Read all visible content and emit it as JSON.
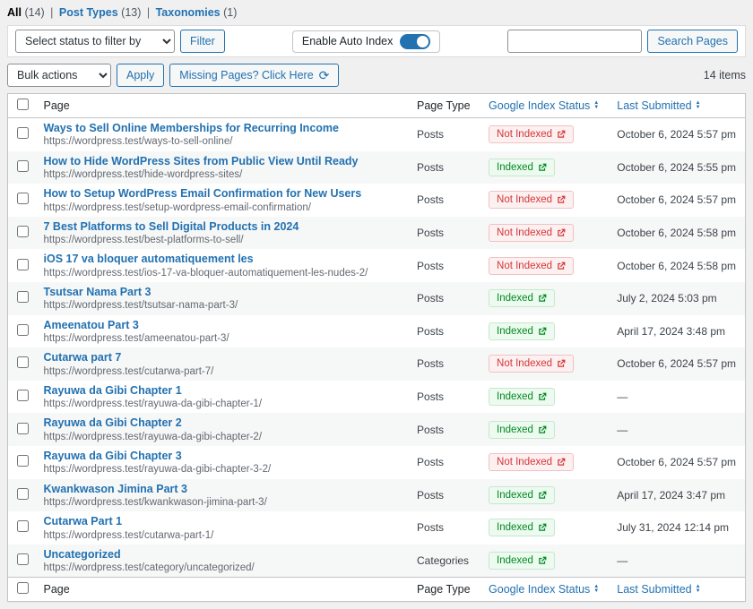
{
  "views": [
    {
      "label": "All",
      "count": "(14)"
    },
    {
      "label": "Post Types",
      "count": "(13)"
    },
    {
      "label": "Taxonomies",
      "count": "(1)"
    }
  ],
  "filters": {
    "status_placeholder": "Select status to filter by",
    "filter_button": "Filter",
    "auto_index_label": "Enable Auto Index",
    "search_button": "Search Pages",
    "search_value": ""
  },
  "bulk": {
    "actions_placeholder": "Bulk actions",
    "apply_button": "Apply",
    "missing_pages_button": "Missing Pages? Click Here",
    "items_count": "14 items"
  },
  "icons": {
    "sort_up": "▲",
    "sort_down": "▼",
    "refresh": "⟳"
  },
  "colors": {
    "accent": "#2271b1",
    "indexed_text": "#008a20",
    "indexed_bg": "#edfaef",
    "not_indexed_text": "#d63638",
    "not_indexed_bg": "#fcf0f1"
  },
  "table": {
    "columns": {
      "page": "Page",
      "page_type": "Page Type",
      "index_status": "Google Index Status",
      "last_submitted": "Last Submitted"
    },
    "rows": [
      {
        "title": "Ways to Sell Online Memberships for Recurring Income",
        "url": "https://wordpress.test/ways-to-sell-online/",
        "type": "Posts",
        "status": "Not Indexed",
        "submitted": "October 6, 2024 5:57 pm"
      },
      {
        "title": "How to Hide WordPress Sites from Public View Until Ready",
        "url": "https://wordpress.test/hide-wordpress-sites/",
        "type": "Posts",
        "status": "Indexed",
        "submitted": "October 6, 2024 5:55 pm"
      },
      {
        "title": "How to Setup WordPress Email Confirmation for New Users",
        "url": "https://wordpress.test/setup-wordpress-email-confirmation/",
        "type": "Posts",
        "status": "Not Indexed",
        "submitted": "October 6, 2024 5:57 pm"
      },
      {
        "title": "7 Best Platforms to Sell Digital Products in 2024",
        "url": "https://wordpress.test/best-platforms-to-sell/",
        "type": "Posts",
        "status": "Not Indexed",
        "submitted": "October 6, 2024 5:58 pm"
      },
      {
        "title": "iOS 17 va bloquer automatiquement les",
        "url": "https://wordpress.test/ios-17-va-bloquer-automatiquement-les-nudes-2/",
        "type": "Posts",
        "status": "Not Indexed",
        "submitted": "October 6, 2024 5:58 pm"
      },
      {
        "title": "Tsutsar Nama Part 3",
        "url": "https://wordpress.test/tsutsar-nama-part-3/",
        "type": "Posts",
        "status": "Indexed",
        "submitted": "July 2, 2024 5:03 pm"
      },
      {
        "title": "Ameenatou Part 3",
        "url": "https://wordpress.test/ameenatou-part-3/",
        "type": "Posts",
        "status": "Indexed",
        "submitted": "April 17, 2024 3:48 pm"
      },
      {
        "title": "Cutarwa part 7",
        "url": "https://wordpress.test/cutarwa-part-7/",
        "type": "Posts",
        "status": "Not Indexed",
        "submitted": "October 6, 2024 5:57 pm"
      },
      {
        "title": "Rayuwa da Gibi Chapter 1",
        "url": "https://wordpress.test/rayuwa-da-gibi-chapter-1/",
        "type": "Posts",
        "status": "Indexed",
        "submitted": "—"
      },
      {
        "title": "Rayuwa da Gibi Chapter 2",
        "url": "https://wordpress.test/rayuwa-da-gibi-chapter-2/",
        "type": "Posts",
        "status": "Indexed",
        "submitted": "—"
      },
      {
        "title": "Rayuwa da Gibi Chapter 3",
        "url": "https://wordpress.test/rayuwa-da-gibi-chapter-3-2/",
        "type": "Posts",
        "status": "Not Indexed",
        "submitted": "October 6, 2024 5:57 pm"
      },
      {
        "title": "Kwankwason Jimina Part 3",
        "url": "https://wordpress.test/kwankwason-jimina-part-3/",
        "type": "Posts",
        "status": "Indexed",
        "submitted": "April 17, 2024 3:47 pm"
      },
      {
        "title": "Cutarwa Part 1",
        "url": "https://wordpress.test/cutarwa-part-1/",
        "type": "Posts",
        "status": "Indexed",
        "submitted": "July 31, 2024 12:14 pm"
      },
      {
        "title": "Uncategorized",
        "url": "https://wordpress.test/category/uncategorized/",
        "type": "Categories",
        "status": "Indexed",
        "submitted": "—"
      }
    ]
  }
}
